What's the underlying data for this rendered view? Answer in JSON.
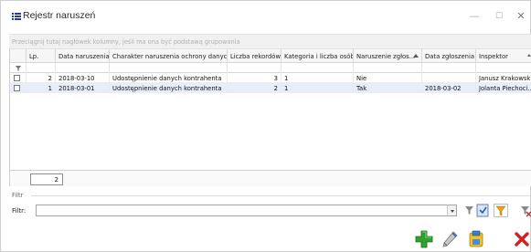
{
  "window": {
    "title": "Rejestr naruszeń",
    "app_icon": "register-list-icon",
    "controls": [
      "minimize-icon",
      "maximize-icon",
      "close-icon"
    ],
    "minimize_glyph": "—",
    "maximize_glyph": "☐",
    "close_glyph": "✕"
  },
  "group_panel": {
    "hint": "Przeciągnij tutaj nagłówek kolumny, jeśli ma ona być podstawą grupowania"
  },
  "grid": {
    "columns": [
      {
        "label": "",
        "key": "check"
      },
      {
        "label": "Lp.",
        "key": "lp"
      },
      {
        "label": "Data naruszenia",
        "key": "data_naruszenia"
      },
      {
        "label": "Charakter naruszenia ochrony danych",
        "key": "charakter"
      },
      {
        "label": "Liczba rekordów",
        "key": "liczba_rekordow"
      },
      {
        "label": "Kategoria i liczba osób",
        "key": "kategoria"
      },
      {
        "label": "Naruszenie zgłos...",
        "key": "zgloszone",
        "sorted": "ascending"
      },
      {
        "label": "Data zgłoszenia",
        "key": "data_zgloszenia"
      },
      {
        "label": "Inspektor",
        "key": "inspektor"
      }
    ],
    "filter_row_icon": "funnel-icon",
    "rows": [
      {
        "lp": "2",
        "data_naruszenia": "2018-03-10",
        "charakter": "Udostępnienie danych kontrahenta",
        "liczba_rekordow": "3",
        "kategoria": "1",
        "zgloszone": "Nie",
        "data_zgloszenia": "",
        "inspektor": "Janusz Krakowski",
        "selected": false
      },
      {
        "lp": "1",
        "data_naruszenia": "2018-03-01",
        "charakter": "Udostępnienie danych kontrahenta",
        "liczba_rekordow": "2",
        "kategoria": "1",
        "zgloszone": "Tak",
        "data_zgloszenia": "2018-03-02",
        "inspektor": "Jolanta Piechoci...",
        "selected": false
      }
    ],
    "row_count": "2"
  },
  "filter": {
    "section_title": "Filtr",
    "label": "Filtr:",
    "value": "",
    "buttons": [
      "filter-clear-icon",
      "toggle-filter-icon",
      "apply-filter-icon",
      "remove-filter-icon"
    ]
  },
  "actions": [
    "add-icon",
    "edit-icon",
    "print-icon",
    "delete-icon"
  ],
  "colors": {
    "selected_row": "#e7eefa",
    "header_bg": "#f6f6f6",
    "add_green": "#2fa12f",
    "delete_red": "#d62020"
  }
}
